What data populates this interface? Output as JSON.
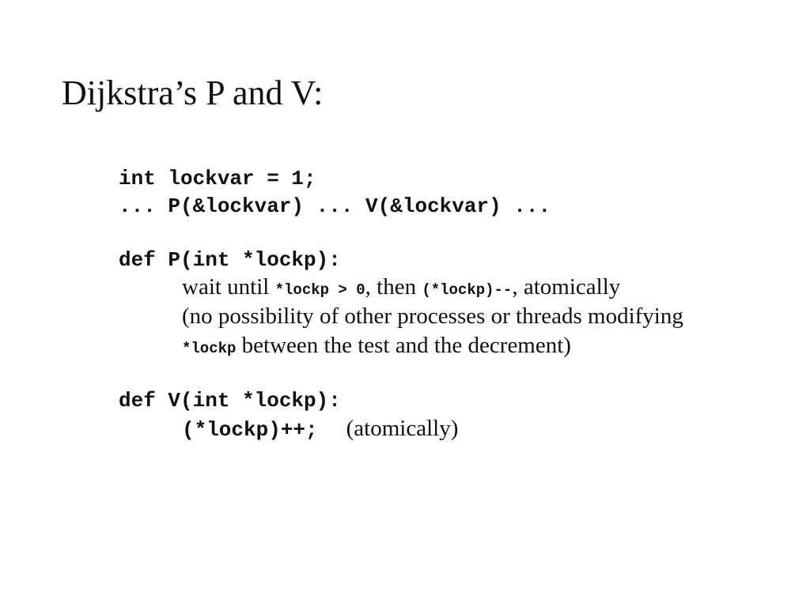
{
  "slide": {
    "title": "Dijkstra’s P and V:",
    "code_decl": "int lockvar = 1;",
    "code_usage": "... P(&lockvar) ... V(&lockvar) ...",
    "p_def": "def P(int *lockp):",
    "p_desc": {
      "line1_a": "wait until ",
      "line1_code1": "*lockp > 0",
      "line1_b": ", then ",
      "line1_code2": "(*lockp)--",
      "line1_c": ", atomically",
      "line2": "(no possibility of other processes or threads modifying",
      "line3_code": "*lockp",
      "line3_text": " between the test and the decrement)"
    },
    "v_def": "def V(int *lockp):",
    "v_body": {
      "code": "(*lockp)++;",
      "note": "(atomically)"
    }
  }
}
